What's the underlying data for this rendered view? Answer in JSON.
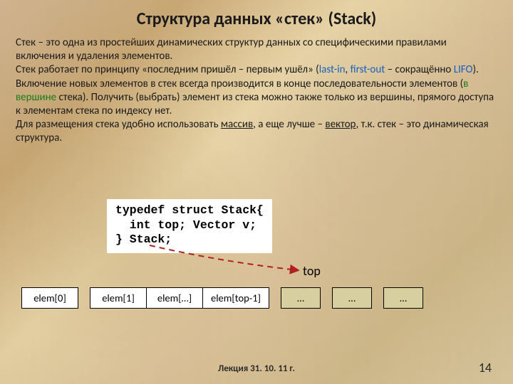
{
  "title": "Структура данных «стек» (Stack)",
  "para": {
    "p1a": "Стек – это одна из простейших динамических структур данных со специфическими правилами включения и удаления элементов.",
    "p2a": "Стек работает по принципу «последним пришёл – первым ушёл» (",
    "p2_blue1": "last-in",
    "p2b": ", ",
    "p2_blue2": "first-out",
    "p2c": " – сокращённо ",
    "p2_blue3": "LIFO",
    "p2d": "). Включение новых элементов в стек всегда производится в конце последовательности элементов (",
    "p2_green": "в вершине",
    "p2e": " стека). Получить (выбрать) элемент из стека можно также только из вершины, прямого доступа к элементам стека по индексу нет.",
    "p3a": "Для размещения стека удобно использовать ",
    "p3_ul1": "массив",
    "p3b": ", а еще лучше – ",
    "p3_ul2": "вектор",
    "p3c": ", т.к. стек – это динамическая структура."
  },
  "code": {
    "l1": "typedef struct Stack{",
    "l2": "  int top; Vector v;",
    "l3": "} Stack;"
  },
  "diagram": {
    "top_label": "top",
    "cells": [
      "elem[0]",
      "elem[1]",
      "elem[…]",
      "elem[top-1]",
      "…",
      "…",
      "…"
    ]
  },
  "footer": "Лекция  31. 10. 11 г.",
  "page": "14"
}
